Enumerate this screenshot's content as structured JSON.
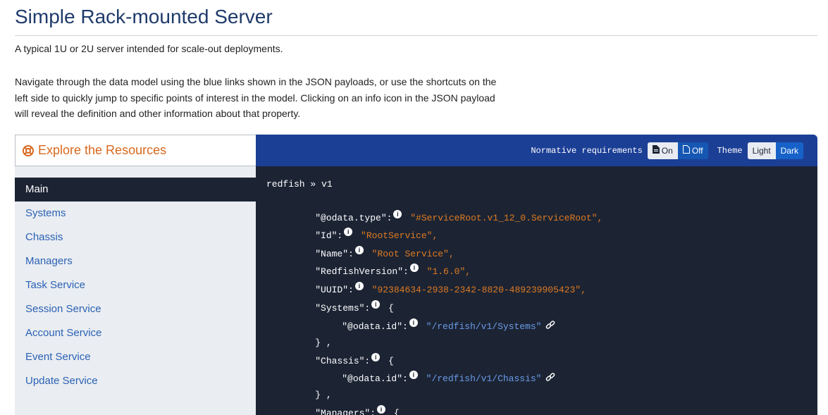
{
  "page": {
    "title": "Simple Rack-mounted Server",
    "subtitle": "A typical 1U or 2U server intended for scale-out deployments.",
    "intro": "Navigate through the data model using the blue links shown in the JSON payloads, or use the shortcuts on the left side to quickly jump to specific points of interest in the model. Clicking on an info icon in the JSON payload will reveal the definition and other information about that property."
  },
  "sidebar": {
    "header": "Explore the Resources",
    "header_icon": "life-ring-icon",
    "items": [
      {
        "label": "Main",
        "active": true
      },
      {
        "label": "Systems"
      },
      {
        "label": "Chassis"
      },
      {
        "label": "Managers"
      },
      {
        "label": "Task Service"
      },
      {
        "label": "Session Service"
      },
      {
        "label": "Account Service"
      },
      {
        "label": "Event Service"
      },
      {
        "label": "Update Service"
      }
    ]
  },
  "toolbar": {
    "normative_label": "Normative requirements",
    "normative_on": "On",
    "normative_off": "Off",
    "theme_label": "Theme",
    "theme_light": "Light",
    "theme_dark": "Dark"
  },
  "code": {
    "breadcrumb": "redfish » v1",
    "lines": [
      {
        "key": "\"@odata.type\":",
        "value": "\"#ServiceRoot.v1_12_0.ServiceRoot\","
      },
      {
        "key": "\"Id\":",
        "value": "\"RootService\","
      },
      {
        "key": "\"Name\":",
        "value": "\"Root Service\","
      },
      {
        "key": "\"RedfishVersion\":",
        "value": "\"1.6.0\","
      },
      {
        "key": "\"UUID\":",
        "value": "\"92384634-2938-2342-8820-489239905423\","
      },
      {
        "key": "\"Systems\":",
        "brace": "{"
      },
      {
        "key": "\"@odata.id\":",
        "link": "\"/redfish/v1/Systems\""
      },
      {
        "close": "} ,"
      },
      {
        "key": "\"Chassis\":",
        "brace": "{"
      },
      {
        "key": "\"@odata.id\":",
        "link": "\"/redfish/v1/Chassis\""
      },
      {
        "close": "} ,"
      },
      {
        "key": "\"Managers\":",
        "brace": "{"
      }
    ]
  },
  "colors": {
    "title": "#1f3b6b",
    "accent_orange": "#d9681d",
    "link_blue": "#2b62b5",
    "code_bg": "#1c2434",
    "header_bg": "#1c3f96",
    "string_orange": "#e07a1f",
    "json_link": "#6b9be8"
  }
}
